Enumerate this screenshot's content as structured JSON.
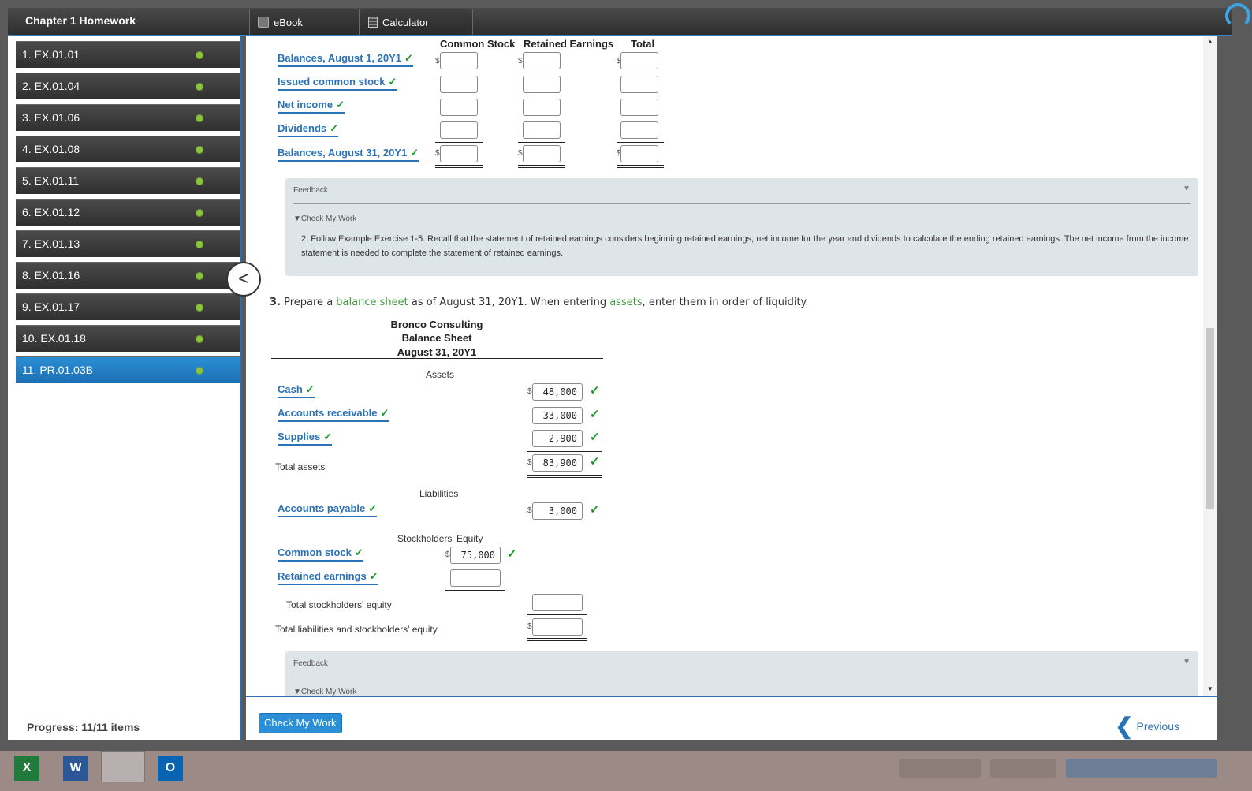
{
  "header": {
    "title": "Chapter 1 Homework",
    "tabs": [
      {
        "label": "eBook"
      },
      {
        "label": "Calculator"
      }
    ]
  },
  "sidebar": {
    "items": [
      {
        "label": "1. EX.01.01"
      },
      {
        "label": "2. EX.01.04"
      },
      {
        "label": "3. EX.01.06"
      },
      {
        "label": "4. EX.01.08"
      },
      {
        "label": "5. EX.01.11"
      },
      {
        "label": "6. EX.01.12"
      },
      {
        "label": "7. EX.01.13"
      },
      {
        "label": "8. EX.01.16"
      },
      {
        "label": "9. EX.01.17"
      },
      {
        "label": "10. EX.01.18"
      },
      {
        "label": "11. PR.01.03B"
      }
    ],
    "progress": "Progress:  11/11 items"
  },
  "equity": {
    "columns": [
      "Common Stock",
      "Retained Earnings",
      "Total"
    ],
    "rows": [
      {
        "label": "Balances, August 1, 20Y1"
      },
      {
        "label": "Issued common stock"
      },
      {
        "label": "Net income"
      },
      {
        "label": "Dividends"
      },
      {
        "label": "Balances, August 31, 20Y1"
      }
    ]
  },
  "feedback1": {
    "title": "Feedback",
    "check": "▼Check My Work",
    "text": "2. Follow Example Exercise 1-5. Recall that the statement of retained earnings considers beginning retained earnings, net income for the year and dividends to calculate the ending retained earnings. The net income from the income statement is needed to complete the statement of retained earnings."
  },
  "q3": {
    "num": "3.",
    "pre": " Prepare a ",
    "link1": "balance sheet",
    "mid": " as of August 31, 20Y1. When entering ",
    "link2": "assets",
    "post": ", enter them in order of liquidity."
  },
  "balance_sheet": {
    "company": "Bronco Consulting",
    "title": "Balance Sheet",
    "date": "August 31, 20Y1",
    "assets_head": "Assets",
    "liab_head": "Liabilities",
    "equity_head": "Stockholders' Equity",
    "cash": {
      "label": "Cash",
      "value": "48,000"
    },
    "ar": {
      "label": "Accounts receivable",
      "value": "33,000"
    },
    "supplies": {
      "label": "Supplies",
      "value": "2,900"
    },
    "total_assets": {
      "label": "Total assets",
      "value": "83,900"
    },
    "ap": {
      "label": "Accounts payable",
      "value": "3,000"
    },
    "cs": {
      "label": "Common stock",
      "value": "75,000"
    },
    "re": {
      "label": "Retained earnings",
      "value": ""
    },
    "total_se": {
      "label": "Total stockholders' equity",
      "value": ""
    },
    "total_le": {
      "label": "Total liabilities and stockholders' equity",
      "value": ""
    }
  },
  "feedback2": {
    "title": "Feedback",
    "check": "▼Check My Work"
  },
  "footer": {
    "check_label": "Check My Work",
    "prev_label": "Previous"
  },
  "symbols": {
    "dollar": "$",
    "check": "✓"
  }
}
